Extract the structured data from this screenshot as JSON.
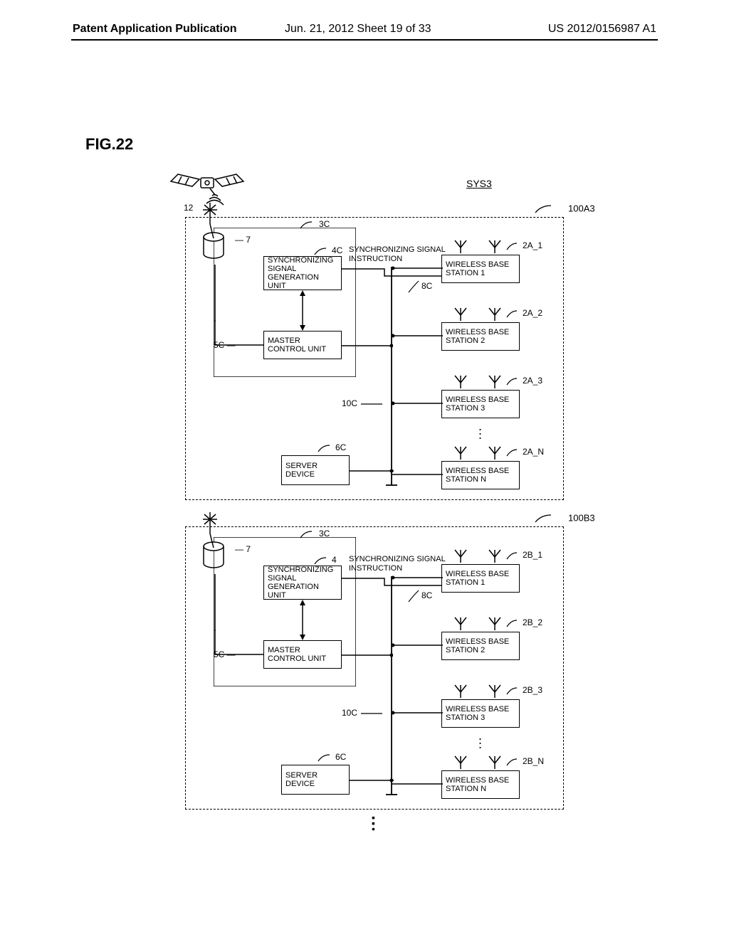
{
  "header": {
    "left": "Patent Application Publication",
    "mid": "Jun. 21, 2012  Sheet 19 of 33",
    "right": "US 2012/0156987 A1"
  },
  "figure_label": "FIG.22",
  "system_label": "SYS3",
  "satellite_ref": "12",
  "subsystems": [
    {
      "id_ref": "100A3",
      "outer_ref": "3C",
      "sync_unit_ref": "4C",
      "master_ref": "5C",
      "server_ref": "6C",
      "db_ref": "7",
      "signal_ref": "8C",
      "bus_ref": "10C",
      "sync_unit_label": "SYNCHRONIZING\nSIGNAL\nGENERATION UNIT",
      "master_label": "MASTER\nCONTROL UNIT",
      "server_label": "SERVER\nDEVICE",
      "signal_label": "SYNCHRONIZING SIGNAL\nINSTRUCTION",
      "stations": [
        {
          "ref": "2A_1",
          "label": "WIRELESS BASE\nSTATION 1"
        },
        {
          "ref": "2A_2",
          "label": "WIRELESS BASE\nSTATION 2"
        },
        {
          "ref": "2A_3",
          "label": "WIRELESS BASE\nSTATION 3"
        },
        {
          "ref": "2A_N",
          "label": "WIRELESS BASE\nSTATION N"
        }
      ]
    },
    {
      "id_ref": "100B3",
      "outer_ref": "3C",
      "sync_unit_ref": "4",
      "master_ref": "5C",
      "server_ref": "6C",
      "db_ref": "7",
      "signal_ref": "8C",
      "bus_ref": "10C",
      "sync_unit_label": "SYNCHRONIZING\nSIGNAL\nGENERATION UNIT",
      "master_label": "MASTER\nCONTROL UNIT",
      "server_label": "SERVER\nDEVICE",
      "signal_label": "SYNCHRONIZING SIGNAL\nINSTRUCTION",
      "stations": [
        {
          "ref": "2B_1",
          "label": "WIRELESS BASE\nSTATION 1"
        },
        {
          "ref": "2B_2",
          "label": "WIRELESS BASE\nSTATION 2"
        },
        {
          "ref": "2B_3",
          "label": "WIRELESS BASE\nSTATION 3"
        },
        {
          "ref": "2B_N",
          "label": "WIRELESS BASE\nSTATION N"
        }
      ]
    }
  ]
}
